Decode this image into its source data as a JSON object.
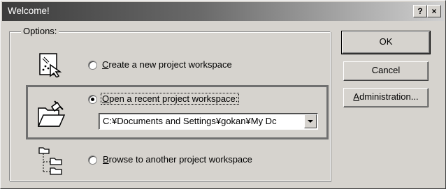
{
  "window": {
    "title": "Welcome!",
    "help_label": "?",
    "close_label": "×"
  },
  "options": {
    "legend": "Options:",
    "create": {
      "prefix": "",
      "mnemonic": "C",
      "rest": "reate a new project workspace",
      "checked": false
    },
    "open": {
      "mnemonic": "O",
      "rest": "pen a recent project workspace:",
      "checked": true,
      "recent_path": "C:¥Documents and Settings¥gokan¥My Dc"
    },
    "browse": {
      "mnemonic": "B",
      "rest": "rowse to another project workspace",
      "checked": false
    }
  },
  "buttons": {
    "ok": "OK",
    "cancel": "Cancel",
    "admin_mnemonic": "A",
    "admin_rest": "dministration..."
  },
  "icons": {
    "create": "new-workspace-icon",
    "open": "open-folder-icon",
    "browse": "folder-tree-icon"
  }
}
